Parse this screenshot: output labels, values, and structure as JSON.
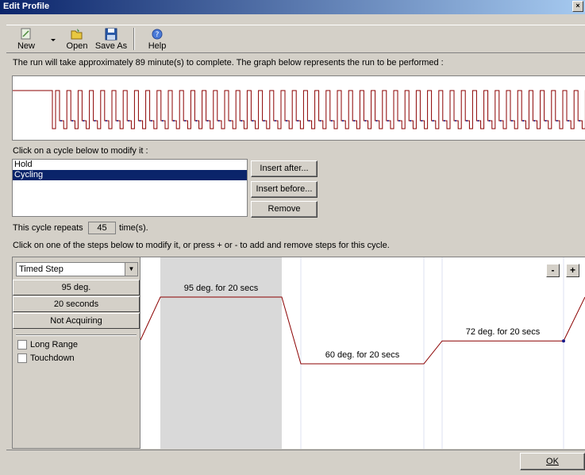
{
  "window": {
    "title": "Edit Profile",
    "close_glyph": "×"
  },
  "toolbar": {
    "new_label": "New",
    "open_label": "Open",
    "save_as_label": "Save As",
    "help_label": "Help",
    "icons": {
      "new": "new-document-icon",
      "open": "folder-open-icon",
      "save_as": "floppy-disk-icon",
      "help": "help-icon"
    }
  },
  "run_message": "The run will take approximately 89 minute(s) to complete. The graph below represents the run to be performed :",
  "cycles": {
    "label": "Click on a cycle below to modify it :",
    "items": [
      {
        "label": "Hold",
        "selected": false
      },
      {
        "label": "Cycling",
        "selected": true
      }
    ],
    "insert_after_label": "Insert after...",
    "insert_before_label": "Insert before...",
    "remove_label": "Remove"
  },
  "repeat": {
    "prefix": "This cycle repeats",
    "count": "45",
    "suffix": "time(s)."
  },
  "steps_instruction": "Click on one of the steps below to modify it, or press + or - to add and remove steps for this cycle.",
  "step_editor": {
    "type_selected": "Timed Step",
    "temperature": "95 deg.",
    "duration": "20 seconds",
    "acquiring": "Not Acquiring",
    "long_range_label": "Long Range",
    "touchdown_label": "Touchdown"
  },
  "step_graph": {
    "minus_label": "-",
    "plus_label": "+",
    "steps": [
      {
        "label": "95 deg. for 20 secs",
        "temperature": 95,
        "seconds": 20,
        "selected": true
      },
      {
        "label": "60 deg. for 20 secs",
        "temperature": 60,
        "seconds": 20,
        "selected": false
      },
      {
        "label": "72 deg. for 20 secs",
        "temperature": 72,
        "seconds": 20,
        "selected": false
      }
    ]
  },
  "ok_label": "OK",
  "colors": {
    "profile_line": "#8b0000",
    "selection": "#0a246a",
    "selected_step_bg": "#d9d9d9"
  }
}
